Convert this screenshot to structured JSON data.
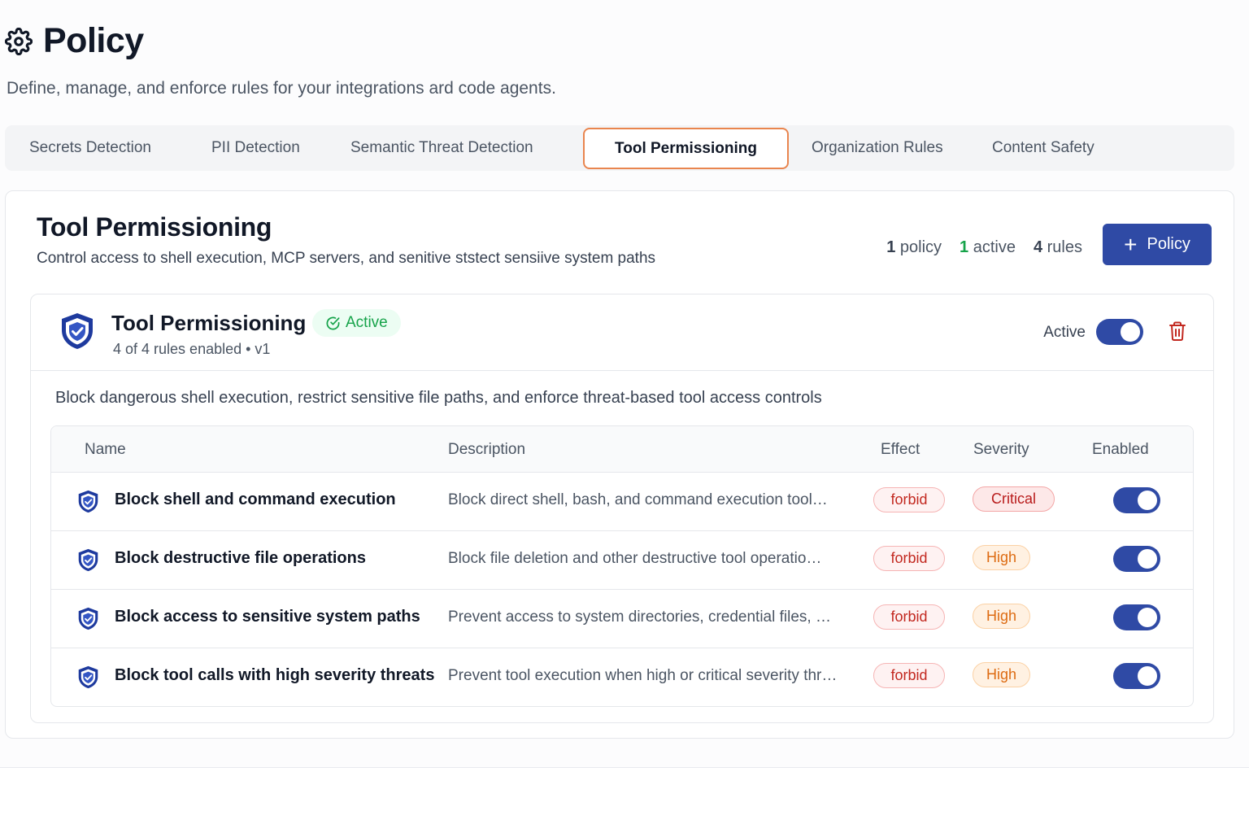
{
  "page": {
    "title": "Policy",
    "subtitle": "Define, manage, and enforce rules for your integrations ard code agents."
  },
  "tabs": [
    {
      "label": "Secrets Detection"
    },
    {
      "label": "PII Detection"
    },
    {
      "label": "Semantic Threat Detection"
    },
    {
      "label": "Tool Permissioning",
      "active": true
    },
    {
      "label": "Organization Rules"
    },
    {
      "label": "Content Safety"
    }
  ],
  "section": {
    "title": "Tool Permissioning",
    "description": "Control access to shell execution, MCP  servers, and senitive ststect sensiive system  paths",
    "stats": {
      "policy_count": "1",
      "policy_label": "policy",
      "active_count": "1",
      "active_label": "active",
      "rules_count": "4",
      "rules_label": "rules"
    },
    "add_button_label": "Policy"
  },
  "policy": {
    "name": "Tool Permissioning",
    "status_badge": "Active",
    "meta": "4 of 4 rules enabled • v1",
    "toggle_label": "Active",
    "toggle_on": true,
    "description": "Block dangerous shell execution, restrict sensitive file paths, and enforce threat-based tool access controls"
  },
  "table": {
    "headers": {
      "name": "Name",
      "description": "Description",
      "effect": "Effect",
      "severity": "Severity",
      "enabled": "Enabled"
    },
    "rows": [
      {
        "name": "Block shell and command execution",
        "description": "Block direct shell, bash, and command execution tool…",
        "effect": "forbid",
        "severity": "Critical",
        "enabled": true
      },
      {
        "name": "Block destructive file operations",
        "description": "Block file deletion and other destructive tool operatio…",
        "effect": "forbid",
        "severity": "High",
        "enabled": true
      },
      {
        "name": "Block access to sensitive system paths",
        "description": "Prevent access to system directories, credential files, …",
        "effect": "forbid",
        "severity": "High",
        "enabled": true
      },
      {
        "name": "Block tool calls with high severity threats",
        "description": "Prevent tool execution when high or critical severity thr…",
        "effect": "forbid",
        "severity": "High",
        "enabled": true
      }
    ]
  },
  "colors": {
    "accent": "#2f4aa5",
    "active_tab_border": "#e9854e",
    "success": "#16a34a",
    "danger": "#c2281f",
    "warning": "#dd6b12"
  },
  "icons": {
    "page": "gear-icon",
    "policy": "shield-check-icon",
    "delete": "trash-icon",
    "add": "plus-icon"
  }
}
